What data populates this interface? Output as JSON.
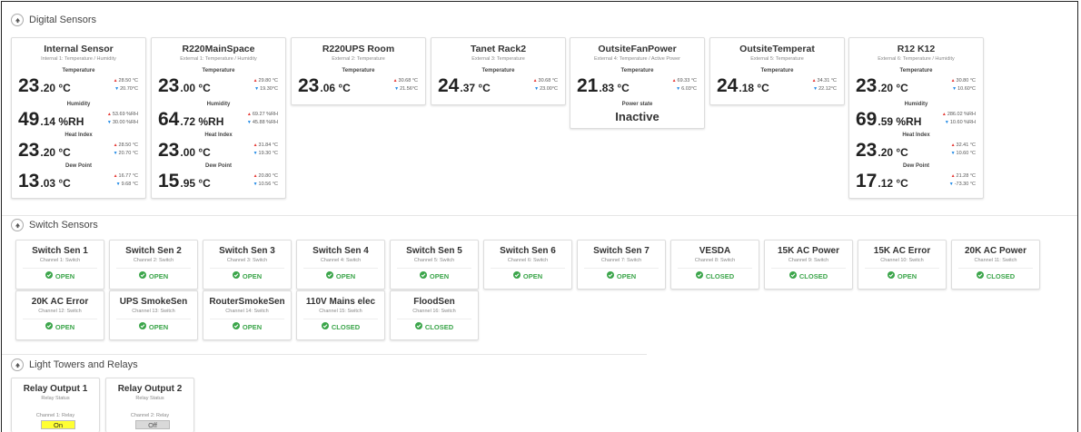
{
  "sections": {
    "digital": "Digital Sensors",
    "switch": "Switch Sensors",
    "lights": "Light Towers and Relays"
  },
  "digital_sensors": [
    {
      "name": "Internal Sensor",
      "sub": "Internal 1: Temperature / Humidity",
      "metrics": [
        {
          "label": "Temperature",
          "int": "23",
          "frac": ".20 °C",
          "max": "28.50 °C",
          "min": "20.70°C"
        },
        {
          "label": "Humidity",
          "int": "49",
          "frac": ".14 %RH",
          "max": "53.69 %RH",
          "min": "30.00 %RH"
        },
        {
          "label": "Heat Index",
          "int": "23",
          "frac": ".20 °C",
          "max": "28.50 °C",
          "min": "20.70 °C"
        },
        {
          "label": "Dew Point",
          "int": "13",
          "frac": ".03 °C",
          "max": "16.77 °C",
          "min": "9.68 °C"
        }
      ]
    },
    {
      "name": "R220MainSpace",
      "sub": "External 1: Temperature / Humidity",
      "metrics": [
        {
          "label": "Temperature",
          "int": "23",
          "frac": ".00 °C",
          "max": "29.80 °C",
          "min": "19.30°C"
        },
        {
          "label": "Humidity",
          "int": "64",
          "frac": ".72 %RH",
          "max": "69.27 %RH",
          "min": "45.88 %RH"
        },
        {
          "label": "Heat Index",
          "int": "23",
          "frac": ".00 °C",
          "max": "31.84 °C",
          "min": "19.30 °C"
        },
        {
          "label": "Dew Point",
          "int": "15",
          "frac": ".95 °C",
          "max": "20.80 °C",
          "min": "10.56 °C"
        }
      ]
    },
    {
      "name": "R220UPS Room",
      "sub": "External 2: Temperature",
      "metrics": [
        {
          "label": "Temperature",
          "int": "23",
          "frac": ".06 °C",
          "max": "30.68 °C",
          "min": "21.56°C"
        }
      ]
    },
    {
      "name": "Tanet Rack2",
      "sub": "External 3: Temperature",
      "metrics": [
        {
          "label": "Temperature",
          "int": "24",
          "frac": ".37 °C",
          "max": "30.68 °C",
          "min": "23.00°C"
        }
      ]
    },
    {
      "name": "OutsiteFanPower",
      "sub": "External 4: Temperature / Active Power",
      "metrics": [
        {
          "label": "Temperature",
          "int": "21",
          "frac": ".83 °C",
          "max": "69.33 °C",
          "min": "6.03°C"
        }
      ],
      "power_state_label": "Power state",
      "power_state": "Inactive"
    },
    {
      "name": "OutsiteTemperat",
      "sub": "External 5: Temperature",
      "metrics": [
        {
          "label": "Temperature",
          "int": "24",
          "frac": ".18 °C",
          "max": "34.31 °C",
          "min": "22.12°C"
        }
      ]
    },
    {
      "name": "R12 K12",
      "sub": "External 6: Temperature / Humidity",
      "metrics": [
        {
          "label": "Temperature",
          "int": "23",
          "frac": ".20 °C",
          "max": "30.80 °C",
          "min": "10.60°C"
        },
        {
          "label": "Humidity",
          "int": "69",
          "frac": ".59 %RH",
          "max": "286.02 %RH",
          "min": "10.60 %RH"
        },
        {
          "label": "Heat Index",
          "int": "23",
          "frac": ".20 °C",
          "max": "32.41 °C",
          "min": "10.60 °C"
        },
        {
          "label": "Dew Point",
          "int": "17",
          "frac": ".12 °C",
          "max": "21.28 °C",
          "min": "-73.30 °C"
        }
      ]
    }
  ],
  "switch_sensors": [
    {
      "name": "Switch Sen 1",
      "sub": "Channel 1: Switch",
      "state": "OPEN"
    },
    {
      "name": "Switch Sen 2",
      "sub": "Channel 2: Switch",
      "state": "OPEN"
    },
    {
      "name": "Switch Sen 3",
      "sub": "Channel 3: Switch",
      "state": "OPEN"
    },
    {
      "name": "Switch Sen 4",
      "sub": "Channel 4: Switch",
      "state": "OPEN"
    },
    {
      "name": "Switch Sen 5",
      "sub": "Channel 5: Switch",
      "state": "OPEN"
    },
    {
      "name": "Switch Sen 6",
      "sub": "Channel 6: Switch",
      "state": "OPEN"
    },
    {
      "name": "Switch Sen 7",
      "sub": "Channel 7: Switch",
      "state": "OPEN"
    },
    {
      "name": "VESDA",
      "sub": "Channel 8: Switch",
      "state": "CLOSED"
    },
    {
      "name": "15K AC Power",
      "sub": "Channel 9: Switch",
      "state": "CLOSED"
    },
    {
      "name": "15K AC Error",
      "sub": "Channel 10: Switch",
      "state": "OPEN"
    },
    {
      "name": "20K AC Power",
      "sub": "Channel 11: Switch",
      "state": "CLOSED"
    },
    {
      "name": "20K AC Error",
      "sub": "Channel 12: Switch",
      "state": "OPEN"
    },
    {
      "name": "UPS SmokeSen",
      "sub": "Channel 13: Switch",
      "state": "OPEN"
    },
    {
      "name": "RouterSmokeSen",
      "sub": "Channel 14: Switch",
      "state": "OPEN"
    },
    {
      "name": "110V Mains elec",
      "sub": "Channel 15: Switch",
      "state": "CLOSED"
    },
    {
      "name": "FloodSen",
      "sub": "Channel 16: Switch",
      "state": "CLOSED"
    }
  ],
  "relays": [
    {
      "name": "Relay Output 1",
      "sub": "Relay Status",
      "channel": "Channel 1: Relay",
      "state": "On",
      "color": "#ffff33"
    },
    {
      "name": "Relay Output 2",
      "sub": "Relay Status",
      "channel": "Channel 2: Relay",
      "state": "Off",
      "color": "#d9d9d9"
    }
  ],
  "colors": {
    "ok_green": "#3ba54a",
    "up_red": "#e53935",
    "down_blue": "#1e88e5"
  },
  "icons": {
    "collapse": "arrow-up-icon",
    "state": "check-circle-icon",
    "max": "triangle-up-icon",
    "min": "triangle-down-icon"
  }
}
